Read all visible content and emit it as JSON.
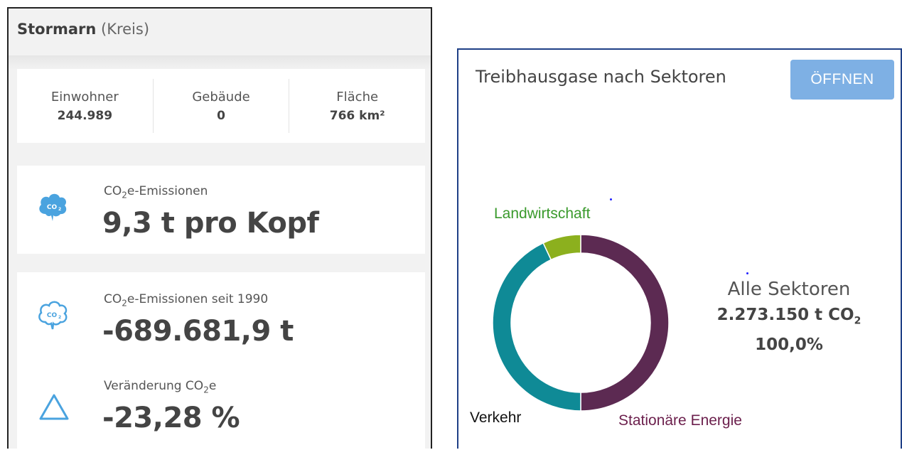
{
  "region": {
    "name": "Stormarn",
    "type": "(Kreis)"
  },
  "stats": [
    {
      "label": "Einwohner",
      "value": "244.989"
    },
    {
      "label": "Gebäude",
      "value": "0"
    },
    {
      "label": "Fläche",
      "value": "766 km²"
    }
  ],
  "emissions_per_capita": {
    "label_prefix": "CO",
    "label_sub": "2",
    "label_suffix": "e-Emissionen",
    "value": "9,3 t pro Kopf",
    "icon": "co2-cloud-filled-icon"
  },
  "emissions_since_1990": {
    "label_prefix": "CO",
    "label_sub": "2",
    "label_suffix": "e-Emissionen seit 1990",
    "value": "-689.681,9 t",
    "icon": "co2-cloud-outline-icon"
  },
  "change": {
    "label_prefix": "Veränderung CO",
    "label_sub": "2",
    "label_suffix": "e",
    "value": "-23,28 %",
    "icon": "triangle-delta-icon"
  },
  "sector_panel": {
    "title": "Treibhausgase nach Sektoren",
    "open_button": "ÖFFNEN",
    "summary_label": "Alle Sektoren",
    "summary_value_prefix": "2.273.150 t CO",
    "summary_value_sub": "2",
    "summary_percent": "100,0%"
  },
  "chart_data": {
    "type": "pie",
    "variant": "donut",
    "title": "Treibhausgase nach Sektoren",
    "slices": [
      {
        "name": "Stationäre Energie",
        "share": 0.5,
        "color": "#5c2a52",
        "label_color": "#6b1f4c"
      },
      {
        "name": "Verkehr",
        "share": 0.43,
        "color": "#0f8a96",
        "label_color": "#111111"
      },
      {
        "name": "Landwirtschaft",
        "share": 0.07,
        "color": "#8cb01e",
        "label_color": "#3a9a2c"
      }
    ]
  },
  "colors": {
    "accent_blue": "#4aa3df",
    "button_bg": "#7eb0e4",
    "panel_border_right": "#1f3f86"
  }
}
